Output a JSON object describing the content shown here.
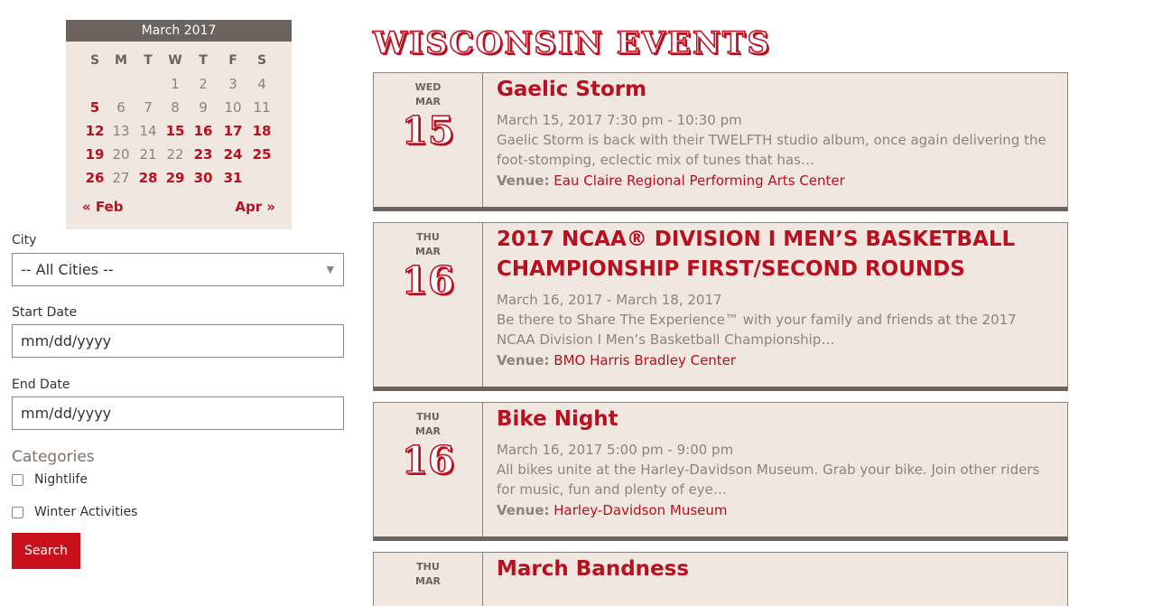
{
  "calendar": {
    "month_title": "March 2017",
    "dow": [
      "S",
      "M",
      "T",
      "W",
      "T",
      "F",
      "S"
    ],
    "weeks": [
      [
        {
          "d": ""
        },
        {
          "d": ""
        },
        {
          "d": ""
        },
        {
          "d": "1"
        },
        {
          "d": "2"
        },
        {
          "d": "3"
        },
        {
          "d": "4"
        }
      ],
      [
        {
          "d": "5",
          "event": true
        },
        {
          "d": "6"
        },
        {
          "d": "7"
        },
        {
          "d": "8"
        },
        {
          "d": "9"
        },
        {
          "d": "10"
        },
        {
          "d": "11"
        }
      ],
      [
        {
          "d": "12",
          "event": true
        },
        {
          "d": "13"
        },
        {
          "d": "14"
        },
        {
          "d": "15",
          "event": true
        },
        {
          "d": "16",
          "event": true
        },
        {
          "d": "17",
          "event": true
        },
        {
          "d": "18",
          "event": true
        }
      ],
      [
        {
          "d": "19",
          "event": true
        },
        {
          "d": "20"
        },
        {
          "d": "21"
        },
        {
          "d": "22"
        },
        {
          "d": "23",
          "event": true
        },
        {
          "d": "24",
          "event": true
        },
        {
          "d": "25",
          "event": true
        }
      ],
      [
        {
          "d": "26",
          "event": true
        },
        {
          "d": "27"
        },
        {
          "d": "28",
          "event": true
        },
        {
          "d": "29",
          "event": true
        },
        {
          "d": "30",
          "event": true
        },
        {
          "d": "31",
          "event": true
        },
        {
          "d": ""
        }
      ]
    ],
    "prev_label": "« Feb",
    "next_label": "Apr »"
  },
  "filters": {
    "city_label": "City",
    "city_value": "-- All Cities --",
    "start_label": "Start Date",
    "start_placeholder": "mm/dd/yyyy",
    "end_label": "End Date",
    "end_placeholder": "mm/dd/yyyy",
    "categories_label": "Categories",
    "categories": [
      "Nightlife",
      "Winter Activities"
    ],
    "search_label": "Search"
  },
  "main": {
    "title": "WISCONSIN EVENTS",
    "venue_prefix": "Venue:",
    "events": [
      {
        "dow": "WED",
        "mon": "MAR",
        "day": "15",
        "title": "Gaelic Storm",
        "time": "March 15, 2017 7:30 pm - 10:30 pm",
        "desc": "Gaelic Storm is back with their TWELFTH studio album, once again delivering the foot-stomping, eclectic mix of tunes that has…",
        "venue": "Eau Claire Regional Performing Arts Center"
      },
      {
        "dow": "THU",
        "mon": "MAR",
        "day": "16",
        "title": "2017 NCAA® DIVISION I MEN’S BASKETBALL CHAMPIONSHIP FIRST/SECOND ROUNDS",
        "time": "March 16, 2017 - March 18, 2017",
        "desc": "Be there to Share The Experience™ with your family and friends at the 2017 NCAA Division I Men’s Basketball Championship…",
        "venue": "BMO Harris Bradley Center"
      },
      {
        "dow": "THU",
        "mon": "MAR",
        "day": "16",
        "title": "Bike Night",
        "time": "March 16, 2017 5:00 pm - 9:00 pm",
        "desc": "All bikes unite at the Harley-Davidson Museum. Grab your bike. Join other riders for music, fun and plenty of eye…",
        "venue": "Harley-Davidson Museum"
      },
      {
        "dow": "THU",
        "mon": "MAR",
        "day": "",
        "title": "March Bandness",
        "time": "",
        "desc": "",
        "venue": ""
      }
    ]
  },
  "colors": {
    "accent": "#b91020",
    "button": "#c8111a",
    "card_bg": "#efe7e0",
    "calendar_header": "#6b635d"
  }
}
